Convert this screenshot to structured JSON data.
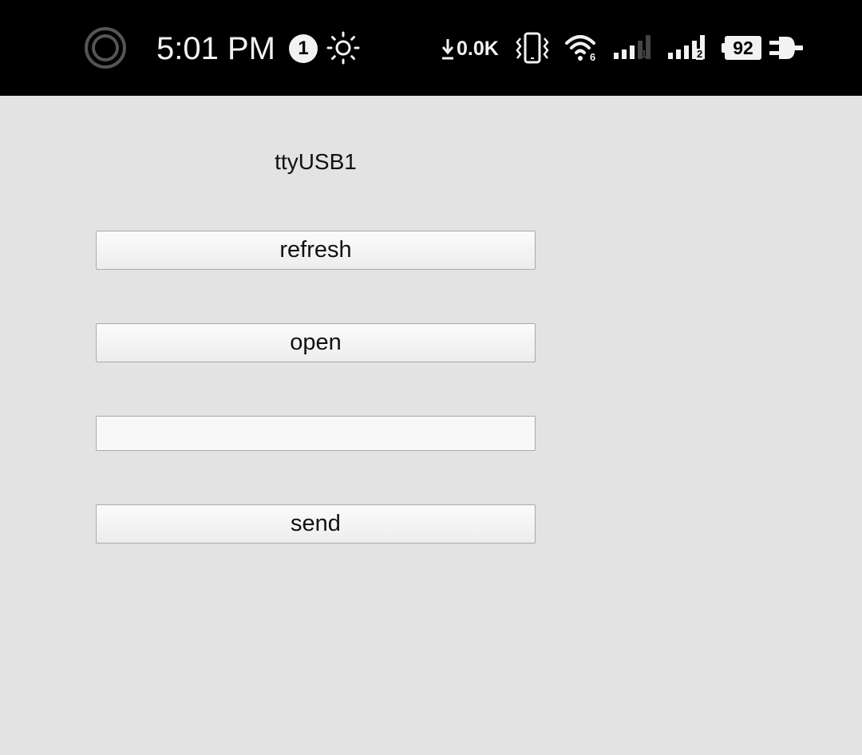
{
  "status_bar": {
    "time": "5:01 PM",
    "notification_count": "1",
    "net_speed": "0.0K",
    "wifi_label": "6",
    "sim1_label": "1",
    "sim2_label": "2",
    "battery_level": "92",
    "icons": [
      "circle-ring-icon",
      "brightness-icon",
      "download-arrow-icon",
      "vibrate-icon",
      "wifi-icon",
      "signal-sim1-icon",
      "signal-sim2-icon",
      "battery-icon",
      "charging-plug-icon"
    ]
  },
  "main": {
    "port_label": "ttyUSB1",
    "refresh_label": "refresh",
    "open_label": "open",
    "input_value": "",
    "send_label": "send"
  }
}
